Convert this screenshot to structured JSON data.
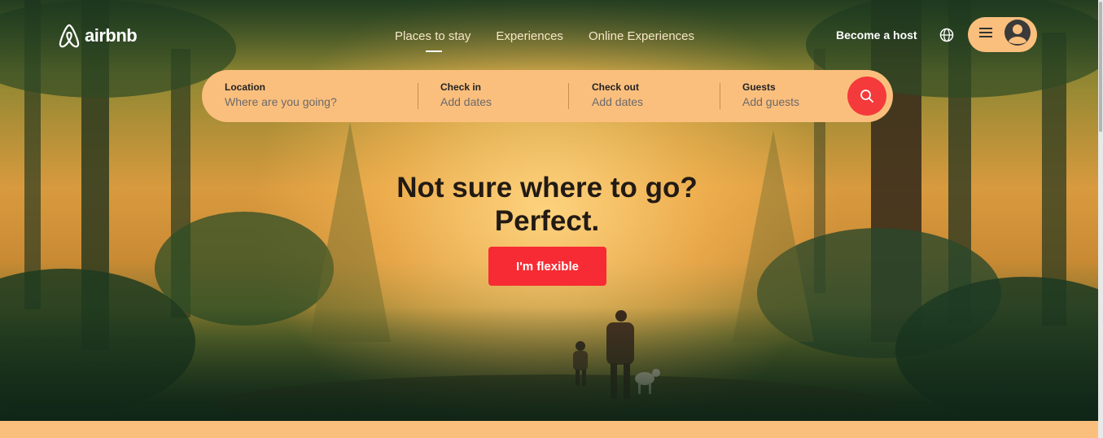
{
  "brand": {
    "name": "airbnb",
    "color": "#ffffff"
  },
  "nav": {
    "links": [
      {
        "label": "Places to stay",
        "active": true
      },
      {
        "label": "Experiences",
        "active": false
      },
      {
        "label": "Online Experiences",
        "active": false
      }
    ]
  },
  "header": {
    "host_label": "Become a host",
    "globe_icon": "globe-icon",
    "menu_icon": "menu-icon",
    "avatar_icon": "user-avatar-icon"
  },
  "search": {
    "fields": [
      {
        "label": "Location",
        "placeholder": "Where are you going?"
      },
      {
        "label": "Check in",
        "placeholder": "Add dates"
      },
      {
        "label": "Check out",
        "placeholder": "Add dates"
      },
      {
        "label": "Guests",
        "placeholder": "Add guests"
      }
    ],
    "button_icon": "search-icon",
    "button_color": "#f43a3a"
  },
  "hero": {
    "headline": "Not sure where to go? Perfect.",
    "cta_label": "I'm flexible",
    "cta_color": "#f72b33"
  },
  "colors": {
    "accent": "#fbbf7d",
    "text_dark": "#221a14"
  }
}
